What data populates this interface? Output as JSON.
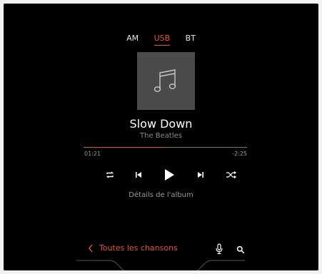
{
  "source_tabs": {
    "am": "AM",
    "usb": "USB",
    "bt": "BT",
    "active": "USB"
  },
  "track": {
    "title": "Slow Down",
    "artist": "The Beatles"
  },
  "progress": {
    "elapsed": "01:21",
    "remaining": "-2:25",
    "fraction": 0.5
  },
  "controls": [
    "repeat-icon",
    "previous-icon",
    "play-icon",
    "next-icon",
    "shuffle-icon"
  ],
  "album_link": "Détails de l'album",
  "bottom": {
    "back_label": "Toutes les chansons"
  },
  "colors": {
    "accent": "#e8542a",
    "background": "#000000",
    "cover": "#4a4a4a"
  }
}
